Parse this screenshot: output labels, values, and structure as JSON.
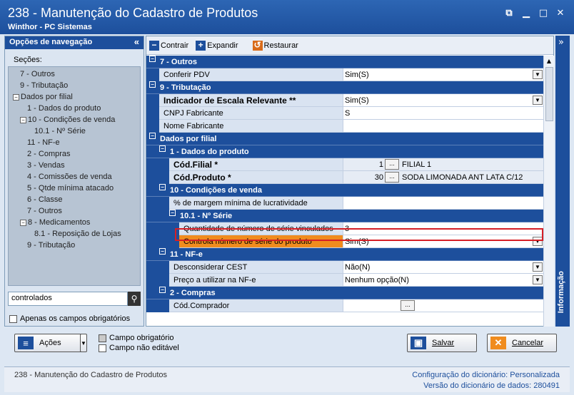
{
  "window": {
    "title": "238 - Manutenção do Cadastro de Produtos",
    "subtitle": "Winthor - PC Sistemas"
  },
  "nav": {
    "header": "Opções de navegação",
    "sections_label": "Seções:",
    "tree": [
      {
        "label": "7 - Outros",
        "level": 1,
        "exp": ""
      },
      {
        "label": "9 - Tributação",
        "level": 1,
        "exp": ""
      },
      {
        "label": "Dados por filial",
        "level": 0,
        "exp": "−"
      },
      {
        "label": "1 - Dados do produto",
        "level": 2,
        "exp": ""
      },
      {
        "label": "10 - Condições de venda",
        "level": 1,
        "exp": "−"
      },
      {
        "label": "10.1 - Nº Série",
        "level": 3,
        "exp": ""
      },
      {
        "label": "11 - NF-e",
        "level": 2,
        "exp": ""
      },
      {
        "label": "2 - Compras",
        "level": 2,
        "exp": ""
      },
      {
        "label": "3 - Vendas",
        "level": 2,
        "exp": ""
      },
      {
        "label": "4 - Comissões de venda",
        "level": 2,
        "exp": ""
      },
      {
        "label": "5 - Qtde mínima atacado",
        "level": 2,
        "exp": ""
      },
      {
        "label": "6 - Classe",
        "level": 2,
        "exp": ""
      },
      {
        "label": "7 - Outros",
        "level": 2,
        "exp": ""
      },
      {
        "label": "8 - Medicamentos",
        "level": 1,
        "exp": "−"
      },
      {
        "label": "8.1 - Reposição de Lojas",
        "level": 3,
        "exp": ""
      },
      {
        "label": "9 - Tributação",
        "level": 2,
        "exp": ""
      }
    ],
    "search_value": "controlados",
    "required_only_label": "Apenas os campos obrigatórios"
  },
  "toolbar": {
    "collapse": "Contrair",
    "expand": "Expandir",
    "restore": "Restaurar"
  },
  "grid": {
    "rows": [
      {
        "type": "cat",
        "indent": 0,
        "label": "7 - Outros"
      },
      {
        "type": "prop",
        "indent": 0,
        "label": "Conferir PDV",
        "value": "Sim(S)",
        "dropdown": true
      },
      {
        "type": "cat",
        "indent": 0,
        "label": "9 - Tributação"
      },
      {
        "type": "prop",
        "indent": 0,
        "label": "Indicador de Escala Relevante **",
        "value": "Sim(S)",
        "dropdown": true,
        "bold": true
      },
      {
        "type": "prop",
        "indent": 0,
        "label": "CNPJ Fabricante",
        "value": "S"
      },
      {
        "type": "prop",
        "indent": 0,
        "label": "Nome Fabricante",
        "value": ""
      },
      {
        "type": "cat",
        "indent": 0,
        "label": "Dados por filial"
      },
      {
        "type": "cat",
        "indent": 1,
        "label": "1 - Dados do produto"
      },
      {
        "type": "lookup",
        "indent": 1,
        "label": "Cód.Filial *",
        "num": "1",
        "desc": "FILIAL 1",
        "bold": true
      },
      {
        "type": "lookup",
        "indent": 1,
        "label": "Cód.Produto *",
        "num": "30",
        "desc": "SODA LIMONADA ANT LATA C/12",
        "bold": true
      },
      {
        "type": "cat",
        "indent": 1,
        "label": "10 - Condições de venda"
      },
      {
        "type": "prop",
        "indent": 1,
        "label": "% de margem mínima de lucratividade",
        "value": ""
      },
      {
        "type": "cat",
        "indent": 2,
        "label": "10.1 - Nº Série"
      },
      {
        "type": "prop",
        "indent": 2,
        "label": "Quantidade de número de série vinculados",
        "value": "3"
      },
      {
        "type": "prop",
        "indent": 2,
        "label": "Controla número de série do produto",
        "value": "Sim(S)",
        "dropdown": true,
        "selected": true
      },
      {
        "type": "cat",
        "indent": 1,
        "label": "11 - NF-e"
      },
      {
        "type": "prop",
        "indent": 1,
        "label": "Desconsiderar CEST",
        "value": "Não(N)",
        "dropdown": true
      },
      {
        "type": "prop",
        "indent": 1,
        "label": "Preço a utilizar na NF-e",
        "value": "Nenhum opção(N)",
        "dropdown": true
      },
      {
        "type": "cat",
        "indent": 1,
        "label": "2 - Compras"
      },
      {
        "type": "ellipsis",
        "indent": 1,
        "label": "Cód.Comprador",
        "value": ""
      }
    ]
  },
  "info_panel": {
    "label": "Informação"
  },
  "bottom": {
    "actions": "Ações",
    "legend_required": "Campo obrigatório",
    "legend_readonly": "Campo não editável",
    "save": "Salvar",
    "cancel": "Cancelar"
  },
  "status": {
    "left": "238 - Manutenção do Cadastro de Produtos",
    "config_label": "Configuração do dicionário:",
    "config_value": "Personalizada",
    "version_label": "Versão do dicionário de dados:",
    "version_value": "280491"
  },
  "colors": {
    "accent": "#1d4f9c",
    "selected": "#f08c1e",
    "highlight": "#d61f26"
  }
}
